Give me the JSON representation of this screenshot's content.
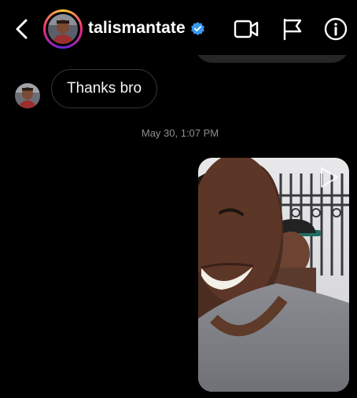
{
  "header": {
    "username": "talismantate",
    "icons": {
      "back": "chevron-left-icon",
      "verified": "verified-badge-icon",
      "video_call": "video-camera-icon",
      "report": "flag-icon",
      "info": "info-icon"
    }
  },
  "messages": [
    {
      "sender": "other",
      "text": "Thanks bro"
    }
  ],
  "timestamp": "May 30, 1:07 PM",
  "shared_media": {
    "type": "video",
    "icon": "play-icon"
  },
  "colors": {
    "background": "#000000",
    "bubble_border": "#363636",
    "timestamp": "#8e8e8e",
    "verified": "#3897f0"
  }
}
